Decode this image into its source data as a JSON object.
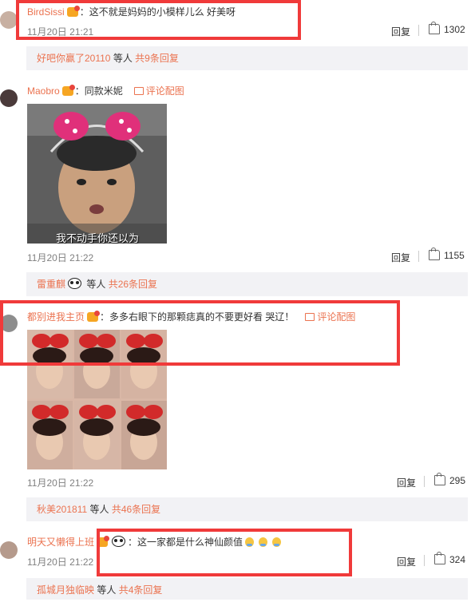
{
  "comments": [
    {
      "username": "BirdSissi",
      "colon": "：",
      "text": "这不就是妈妈的小模样儿么 好美呀",
      "time": "11月20日 21:21",
      "reply": "回复",
      "likes": "1302",
      "sub": {
        "who": "好吧你赢了20110",
        "etc": " 等人 ",
        "count": "共9条回复"
      }
    },
    {
      "username": "Maobro",
      "colon": "：",
      "text": "同款米妮",
      "pic_link": "评论配图",
      "image_caption": "我不动手你还以为",
      "time": "11月20日 21:22",
      "reply": "回复",
      "likes": "1155",
      "sub": {
        "who": "雷重麒",
        "etc": " 等人 ",
        "count": "共26条回复"
      }
    },
    {
      "username": "都别进我主页",
      "colon": "：",
      "text": "多多右眼下的那颗痣真的不要更好看 哭辽！",
      "pic_link": "评论配图",
      "time": "11月20日 21:22",
      "reply": "回复",
      "likes": "295",
      "sub": {
        "who": "秋美201811",
        "etc": " 等人 ",
        "count": "共46条回复"
      }
    },
    {
      "username": "明天又懒得上班",
      "colon": "：",
      "text": "这一家都是什么神仙颜值",
      "time": "11月20日 21:22",
      "reply": "回复",
      "likes": "324",
      "sub": {
        "who": "孤城月独临映",
        "etc": " 等人 ",
        "count": "共4条回复"
      }
    }
  ],
  "colors": {
    "accent": "#eb7350",
    "highlight_box": "#f03a3a",
    "subbar_bg": "#f2f2f5"
  },
  "icons": [
    "vip-badge-icon",
    "picture-icon",
    "like-icon",
    "panda-emoji-icon",
    "crying-emoji-icon"
  ]
}
